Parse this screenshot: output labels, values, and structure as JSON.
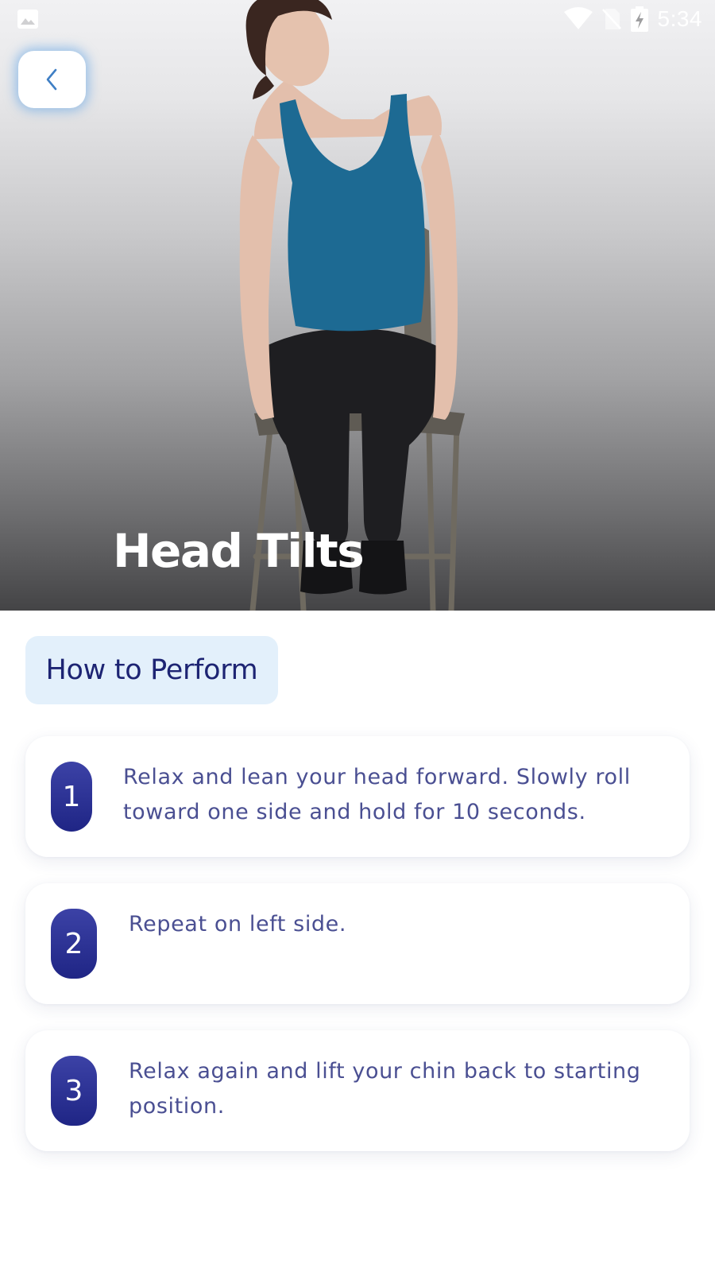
{
  "status_bar": {
    "time": "5:34",
    "icons": [
      "gallery-icon",
      "wifi-icon",
      "no-sim-icon",
      "battery-charging-icon"
    ]
  },
  "back_button": {
    "icon": "chevron-left-icon"
  },
  "exercise": {
    "title": "Head Tilts"
  },
  "section": {
    "label": "How to Perform"
  },
  "steps": [
    {
      "number": "1",
      "text": "Relax and lean your head forward. Slowly roll toward one side and hold for 10 seconds."
    },
    {
      "number": "2",
      "text": "Repeat on left side."
    },
    {
      "number": "3",
      "text": "Relax again and lift your chin back to starting position."
    }
  ],
  "colors": {
    "accent_dark": "#1f2585",
    "chip_background": "#e3f0fb",
    "step_text": "#4a4f92",
    "section_label": "#1d2473"
  }
}
